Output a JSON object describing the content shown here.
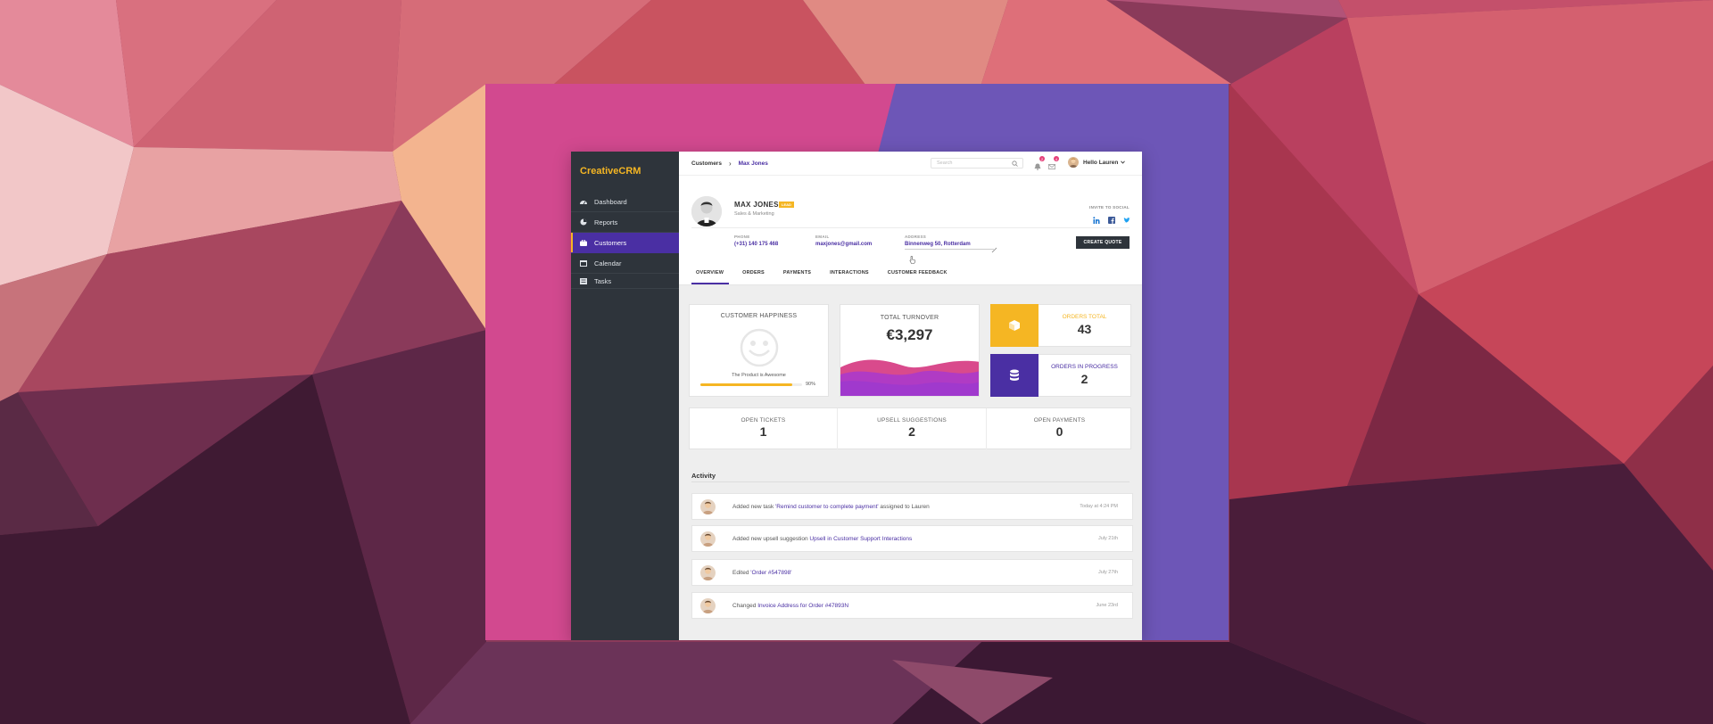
{
  "app": {
    "logo": "CreativeCRM",
    "colors": {
      "accent": "#4a2fa3",
      "brand": "#f5b623",
      "sidebar": "#2e343b",
      "magenta": "#d14a8c"
    }
  },
  "sidebar": {
    "items": [
      {
        "label": "Dashboard",
        "icon": "dashboard-icon",
        "active": false
      },
      {
        "label": "Reports",
        "icon": "pie-chart-icon",
        "active": false
      },
      {
        "label": "Customers",
        "icon": "briefcase-icon",
        "active": true
      },
      {
        "label": "Calendar",
        "icon": "calendar-icon",
        "active": false
      },
      {
        "label": "Tasks",
        "icon": "list-icon",
        "active": false
      }
    ]
  },
  "topbar": {
    "breadcrumb": [
      "Customers",
      "Max Jones"
    ],
    "search_placeholder": "Search",
    "notif_count_1": "2",
    "notif_count_2": "4",
    "user_greeting": "Hello Lauren"
  },
  "profile": {
    "name": "MAX JONES",
    "tag": "LEAD",
    "role": "Sales & Marketing",
    "social_label": "INVITE TO SOCIAL",
    "phone_label": "PHONE",
    "phone": "(+31) 140 175 468",
    "email_label": "EMAIL",
    "email": "maxjones@gmail.com",
    "address_label": "ADDRESS",
    "address": "Binnenweg 50, Rotterdam",
    "quote_button": "CREATE QUOTE"
  },
  "tabs": [
    "OVERVIEW",
    "ORDERS",
    "PAYMENTS",
    "INTERACTIONS",
    "CUSTOMER FEEDBACK"
  ],
  "cards": {
    "happiness": {
      "title": "CUSTOMER HAPPINESS",
      "caption": "The Product is Awesome",
      "percent_label": "90%",
      "percent": 0.9
    },
    "turnover": {
      "title": "TOTAL TURNOVER",
      "value": "€3,297"
    },
    "orders_total": {
      "label": "ORDERS TOTAL",
      "value": "43",
      "color": "#f5b623"
    },
    "orders_progress": {
      "label": "ORDERS IN PROGRESS",
      "value": "2",
      "color": "#4a2fa3"
    }
  },
  "stats": [
    {
      "label": "OPEN TICKETS",
      "value": "1"
    },
    {
      "label": "UPSELL SUGGESTIONS",
      "value": "2"
    },
    {
      "label": "OPEN PAYMENTS",
      "value": "0"
    }
  ],
  "activity": {
    "title": "Activity",
    "rows": [
      {
        "pre": "Added new task ",
        "link": "'Remind customer to complete payment'",
        "post": " assigned to Lauren",
        "time": "Today at 4:24 PM"
      },
      {
        "pre": "Added new upsell suggestion ",
        "link": "Upsell in Customer Support Interactions",
        "post": "",
        "time": "July 21th"
      },
      {
        "pre": "Edited ",
        "link": "'Order #547898'",
        "post": "",
        "time": "July 27th"
      },
      {
        "pre": "Changed ",
        "link": "Invoice Address for Order #47893N",
        "post": "",
        "time": "June 23rd"
      }
    ]
  }
}
